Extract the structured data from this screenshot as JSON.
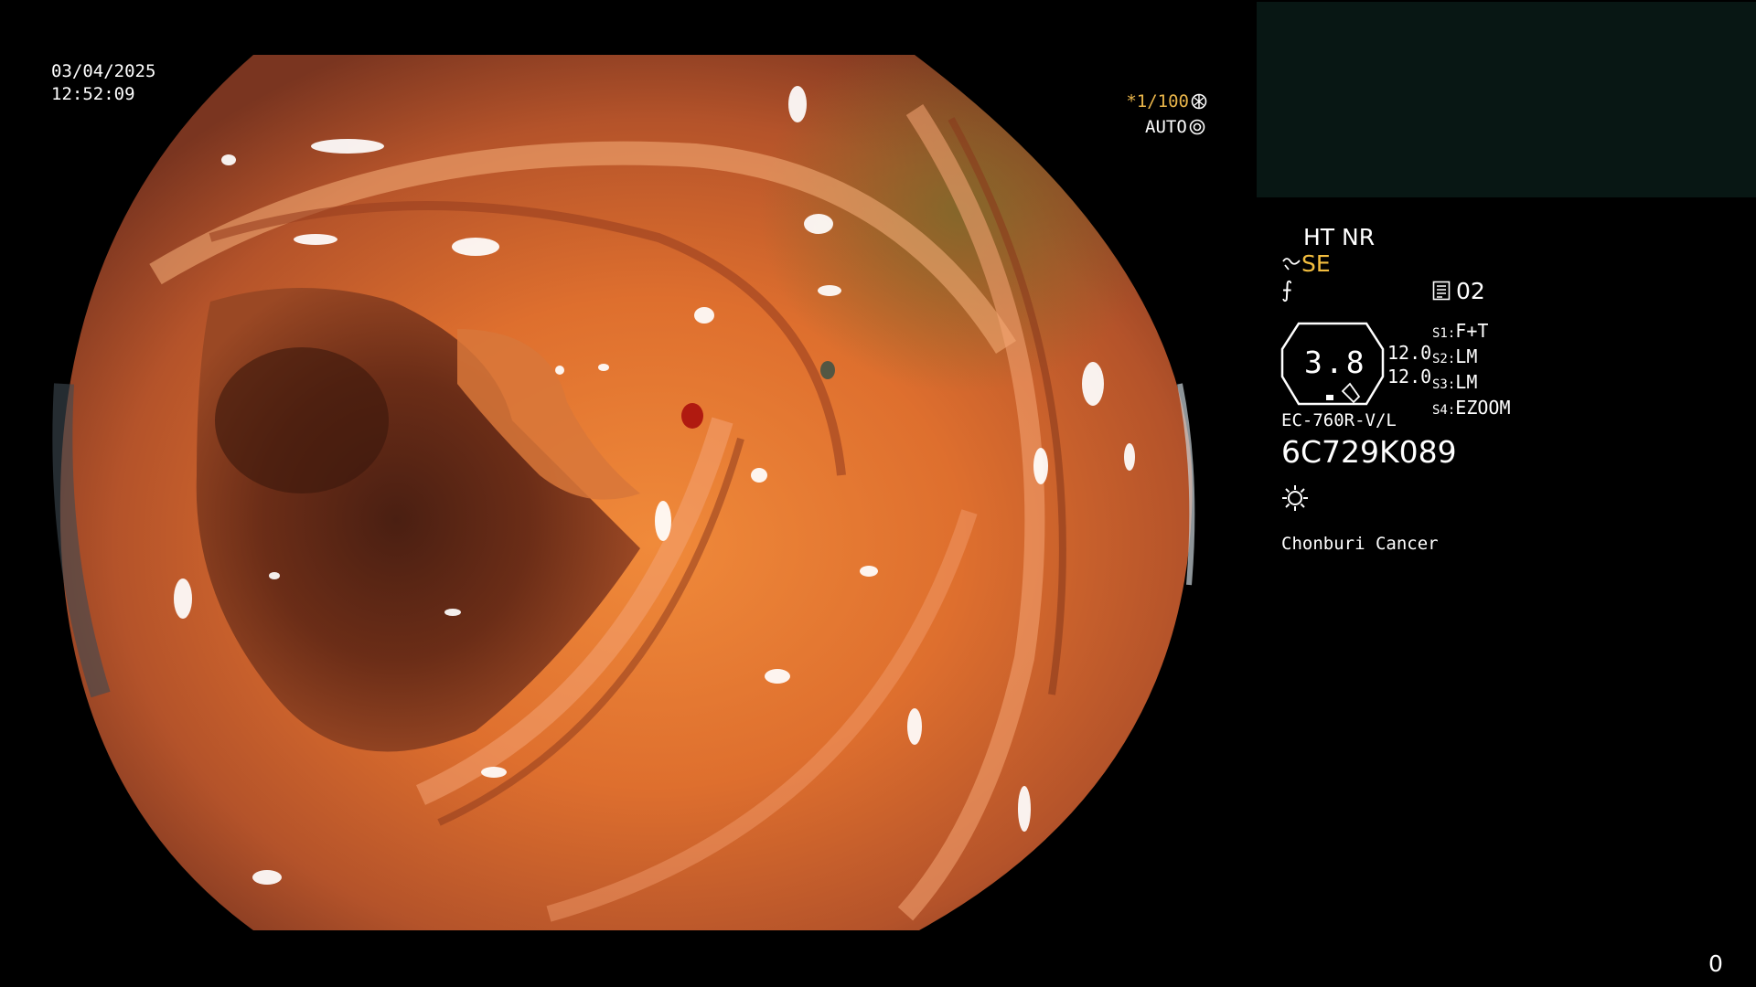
{
  "overlay": {
    "date": "03/04/2025",
    "time": "12:52:09",
    "shutter_prefix": "*1/100",
    "shutter_icon": "aperture-icon",
    "iris_mode": "AUTO",
    "iris_icon": "iris-icon"
  },
  "panel": {
    "enhancement": "HT NR",
    "structure_icon": "structure-enhance-icon",
    "structure_value": "SE",
    "color_icon": "color-tone-icon",
    "color_glyph": "⨍",
    "record_icon": "record-icon",
    "record_count": "02",
    "zoom_level": "3.8",
    "zoom_values": [
      "12.0",
      "12.0"
    ],
    "switches": [
      {
        "key": "S1:",
        "value": "F+T"
      },
      {
        "key": "S2:",
        "value": "LM"
      },
      {
        "key": "S3:",
        "value": "LM"
      },
      {
        "key": "S4:",
        "value": "EZOOM"
      }
    ],
    "scope_model": "EC-760R-V/L",
    "scope_serial": "6C729K089",
    "light_icon": "light-source-icon",
    "hospital": "Chonburi Cancer",
    "frame_counter": "0"
  },
  "colors": {
    "highlight": "#f3be3f",
    "thumbnail_bg": "#081714",
    "mucosa": "#d8703a"
  }
}
